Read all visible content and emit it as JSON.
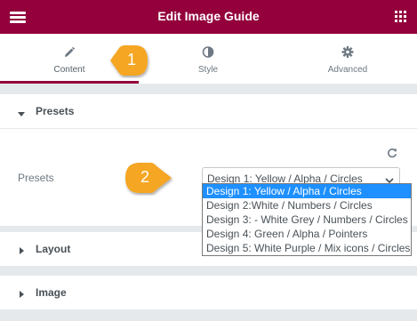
{
  "header": {
    "title": "Edit Image Guide",
    "menu_icon": "hamburger-icon",
    "apps_icon": "grid-icon",
    "background": "#93003c"
  },
  "tabs": [
    {
      "label": "Content",
      "icon": "pencil-icon",
      "active": true
    },
    {
      "label": "Style",
      "icon": "half-circle-icon",
      "active": false
    },
    {
      "label": "Advanced",
      "icon": "gear-icon",
      "active": false
    }
  ],
  "presets_section": {
    "title": "Presets",
    "field_label": "Presets",
    "selected_value": "Design 1: Yellow / Alpha / Circles",
    "options": [
      "Design 1: Yellow / Alpha / Circles",
      "Design 2:White / Numbers / Circles",
      "Design 3: - White Grey / Numbers / Circles",
      "Design 4: Green / Alpha / Pointers",
      "Design 5: White Purple / Mix icons / Circles"
    ],
    "selected_highlight_color": "#1e90ff"
  },
  "layout_section": {
    "title": "Layout"
  },
  "image_section": {
    "title": "Image"
  },
  "callouts": [
    {
      "number": "1",
      "color": "#f5a623"
    },
    {
      "number": "2",
      "color": "#f5a623"
    }
  ]
}
